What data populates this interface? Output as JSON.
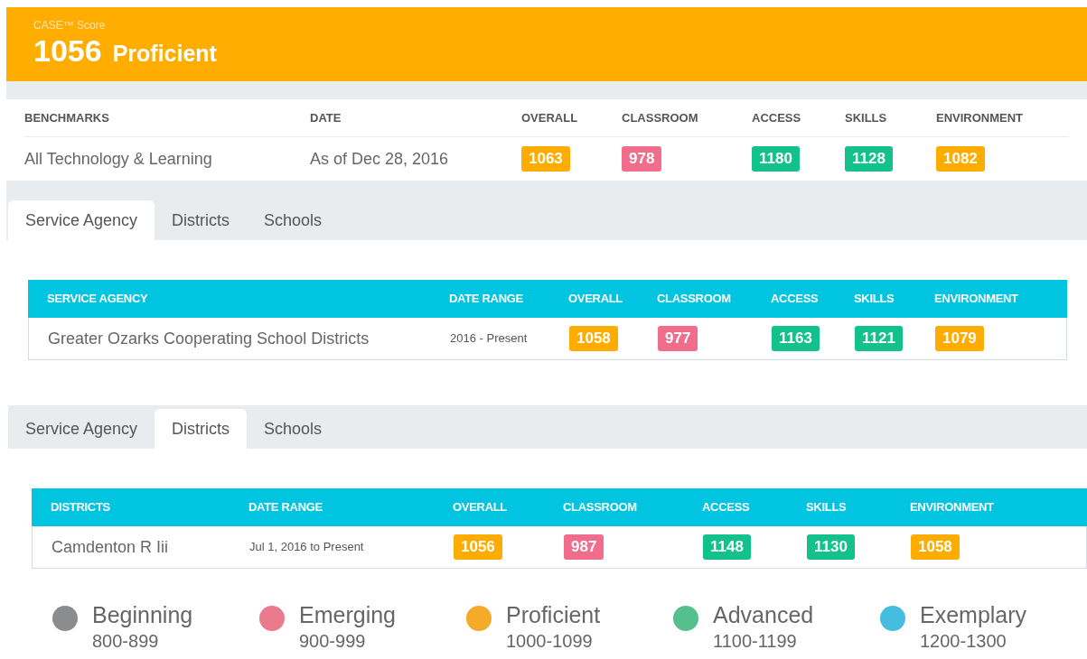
{
  "score_header": {
    "label": "CASE™ Score",
    "score": "1056",
    "level": "Proficient"
  },
  "benchmarks": {
    "columns": [
      "BENCHMARKS",
      "DATE",
      "OVERALL",
      "CLASSROOM",
      "ACCESS",
      "SKILLS",
      "ENVIRONMENT"
    ],
    "rows": [
      {
        "name": "All Technology & Learning",
        "date": "As of Dec 28, 2016",
        "scores": [
          {
            "value": "1063",
            "color": "#ffac00"
          },
          {
            "value": "978",
            "color": "#f06d8b"
          },
          {
            "value": "1180",
            "color": "#12c28a"
          },
          {
            "value": "1128",
            "color": "#12c28a"
          },
          {
            "value": "1082",
            "color": "#ffac00"
          }
        ]
      }
    ]
  },
  "sections": [
    {
      "tabs": [
        {
          "label": "Service Agency",
          "selected": true
        },
        {
          "label": "Districts",
          "selected": false
        },
        {
          "label": "Schools",
          "selected": false
        }
      ],
      "columns": [
        "SERVICE AGENCY",
        "DATE RANGE",
        "OVERALL",
        "CLASSROOM",
        "ACCESS",
        "SKILLS",
        "ENVIRONMENT"
      ],
      "rows": [
        {
          "name": "Greater Ozarks Cooperating School Districts",
          "date": "2016 - Present",
          "scores": [
            {
              "value": "1058",
              "color": "#ffac00"
            },
            {
              "value": "977",
              "color": "#f06d8b"
            },
            {
              "value": "1163",
              "color": "#12c28a"
            },
            {
              "value": "1121",
              "color": "#12c28a"
            },
            {
              "value": "1079",
              "color": "#ffac00"
            }
          ]
        }
      ]
    },
    {
      "tabs": [
        {
          "label": "Service Agency",
          "selected": false
        },
        {
          "label": "Districts",
          "selected": true
        },
        {
          "label": "Schools",
          "selected": false
        }
      ],
      "columns": [
        "DISTRICTS",
        "DATE RANGE",
        "OVERALL",
        "CLASSROOM",
        "ACCESS",
        "SKILLS",
        "ENVIRONMENT"
      ],
      "rows": [
        {
          "name": "Camdenton R Iii",
          "date": "Jul 1, 2016 to Present",
          "scores": [
            {
              "value": "1056",
              "color": "#ffac00"
            },
            {
              "value": "987",
              "color": "#f06d8b"
            },
            {
              "value": "1148",
              "color": "#12c28a"
            },
            {
              "value": "1130",
              "color": "#12c28a"
            },
            {
              "value": "1058",
              "color": "#ffac00"
            }
          ]
        }
      ]
    }
  ],
  "legend": [
    {
      "name": "Beginning",
      "range": "800-899",
      "color": "#8a8c8e"
    },
    {
      "name": "Emerging",
      "range": "900-999",
      "color": "#e97b8c"
    },
    {
      "name": "Proficient",
      "range": "1000-1099",
      "color": "#f5aa2a"
    },
    {
      "name": "Advanced",
      "range": "1100-1199",
      "color": "#55c08e"
    },
    {
      "name": "Exemplary",
      "range": "1200-1300",
      "color": "#45bde0"
    }
  ]
}
